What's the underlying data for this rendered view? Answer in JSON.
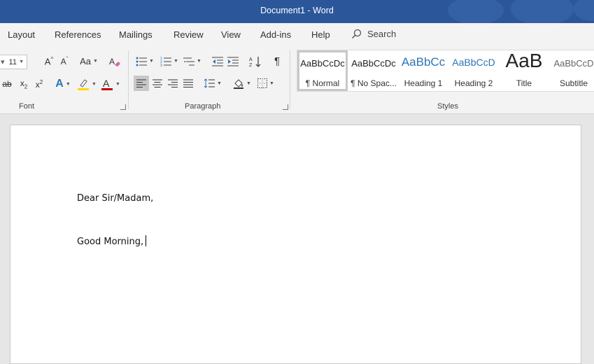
{
  "window": {
    "title": "Document1  -  Word"
  },
  "menu": {
    "items": [
      "Layout",
      "References",
      "Mailings",
      "Review",
      "View",
      "Add-ins",
      "Help"
    ],
    "search_label": "Search"
  },
  "font_group": {
    "label": "Font",
    "size_value": "11",
    "change_case_label": "Aa"
  },
  "paragraph_group": {
    "label": "Paragraph"
  },
  "styles_group": {
    "label": "Styles",
    "items": [
      {
        "preview": "AaBbCcDc",
        "name": "¶ Normal"
      },
      {
        "preview": "AaBbCcDc",
        "name": "¶ No Spac..."
      },
      {
        "preview": "AaBbCc",
        "name": "Heading 1"
      },
      {
        "preview": "AaBbCcD",
        "name": "Heading 2"
      },
      {
        "preview": "AaB",
        "name": "Title"
      },
      {
        "preview": "AaBbCcD",
        "name": "Subtitle"
      }
    ]
  },
  "document": {
    "lines": [
      "Dear Sir/Madam,",
      "Good Morning,"
    ]
  },
  "colors": {
    "title_bar": "#2b579a",
    "highlight": "#ffd800",
    "font_color": "#c00000",
    "heading": "#2e74b5"
  }
}
